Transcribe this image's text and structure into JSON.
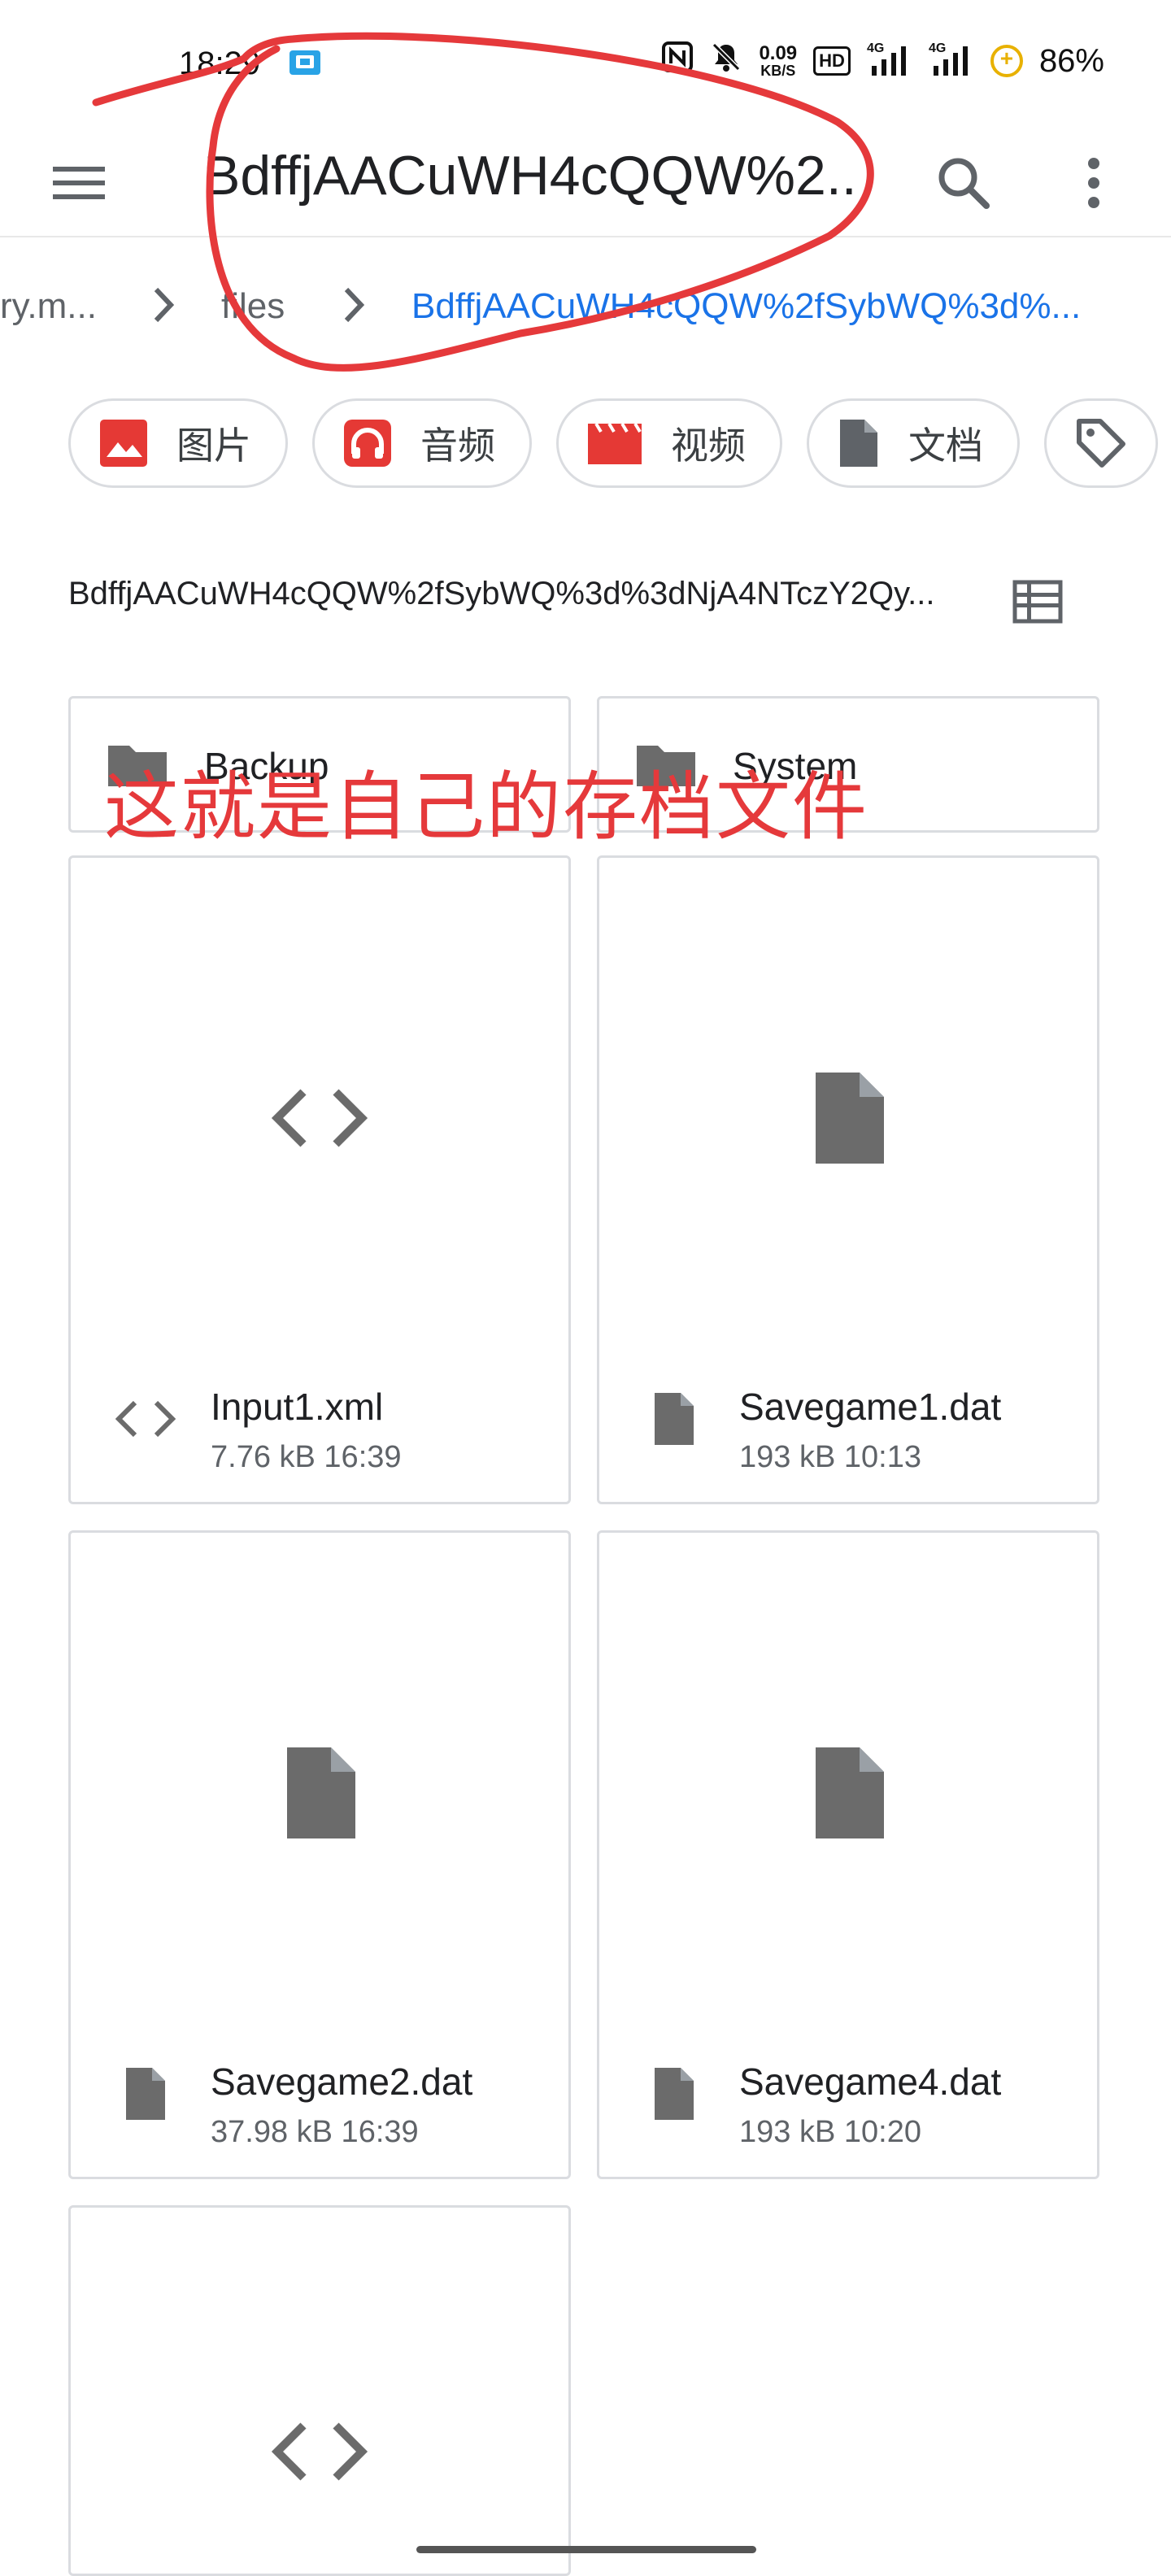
{
  "status_bar": {
    "time": "18:29",
    "net_speed_value": "0.09",
    "net_speed_unit": "KB/S",
    "hd_badge": "HD",
    "signal1_label": "4G",
    "signal2_label": "4G",
    "battery": "86%",
    "icons": [
      "app-notification-icon",
      "nfc-icon",
      "mute-icon",
      "signal-icon",
      "battery-saver-icon"
    ]
  },
  "app_bar": {
    "title": "BdffjAACuWH4cQQW%2..",
    "icons": [
      "menu-icon",
      "search-icon",
      "more-vert-icon"
    ]
  },
  "breadcrumb": {
    "items": [
      "ry.m...",
      "files",
      "BdffjAACuWH4cQQW%2fSybWQ%3d%..."
    ],
    "separator_icon": "chevron-right-icon"
  },
  "filter_chips": [
    {
      "label": "图片",
      "icon": "image-icon"
    },
    {
      "label": "音频",
      "icon": "headphones-icon"
    },
    {
      "label": "视频",
      "icon": "movie-icon"
    },
    {
      "label": "文档",
      "icon": "document-icon"
    },
    {
      "label": "",
      "icon": "tag-icon"
    }
  ],
  "path_row": {
    "text": "BdffjAACuWH4cQQW%2fSybWQ%3d%3dNjA4NTczY2Qy...",
    "view_icon": "list-view-icon"
  },
  "folders": [
    {
      "name": "Backup",
      "icon": "folder-icon"
    },
    {
      "name": "System",
      "icon": "folder-icon"
    }
  ],
  "files": [
    {
      "name": "Input1.xml",
      "meta": "7.76 kB 16:39",
      "icon": "code-icon"
    },
    {
      "name": "Savegame1.dat",
      "meta": "193 kB 10:13",
      "icon": "file-icon"
    },
    {
      "name": "Savegame2.dat",
      "meta": "37.98 kB 16:39",
      "icon": "file-icon"
    },
    {
      "name": "Savegame4.dat",
      "meta": "193 kB 10:20",
      "icon": "file-icon"
    },
    {
      "name": "",
      "meta": "",
      "icon": "code-icon"
    }
  ],
  "annotation": {
    "text": "这就是自己的存档文件",
    "color": "#e5393b"
  },
  "colors": {
    "accent": "#1a73e8",
    "chip_icon_red": "#e53935",
    "file_icon_gray": "#6b6b6b",
    "card_border": "#dadce0"
  }
}
